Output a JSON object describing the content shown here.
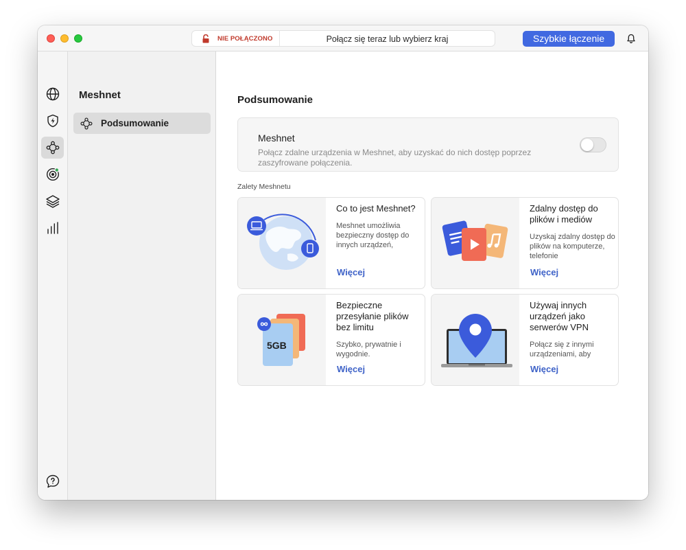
{
  "titlebar": {
    "status": "NIE POŁĄCZONO",
    "prompt": "Połącz się teraz lub wybierz kraj",
    "quick_connect_label": "Szybkie łączenie"
  },
  "rail": {
    "items": [
      {
        "icon": "globe-icon",
        "active": false
      },
      {
        "icon": "shield-bolt-icon",
        "active": false
      },
      {
        "icon": "meshnet-icon",
        "active": true
      },
      {
        "icon": "target-icon",
        "active": false
      },
      {
        "icon": "layers-icon",
        "active": false
      },
      {
        "icon": "stats-icon",
        "active": false
      }
    ],
    "bottom": [
      {
        "icon": "help-icon"
      },
      {
        "icon": "settings-icon"
      }
    ]
  },
  "sidebar": {
    "title": "Meshnet",
    "items": [
      {
        "label": "Podsumowanie",
        "icon": "meshnet-icon",
        "active": true
      }
    ]
  },
  "main": {
    "title": "Podsumowanie",
    "meshnet_card": {
      "title": "Meshnet",
      "description": "Połącz zdalne urządzenia w Meshnet, aby uzyskać do nich dostęp poprzez zaszyfrowane połączenia.",
      "toggle_on": false
    },
    "section_label": "Zalety Meshnetu",
    "features": [
      {
        "title": "Co to jest Meshnet?",
        "description": "Meshnet umożliwia bezpieczny dostęp do innych urządzeń,",
        "more": "Więcej",
        "image": "globe-devices-illustration"
      },
      {
        "title": "Zdalny dostęp do plików i mediów",
        "description": "Uzyskaj zdalny dostęp do plików na komputerze, telefonie",
        "more": "Więcej",
        "image": "media-files-illustration"
      },
      {
        "title": "Bezpieczne przesyłanie plików bez limitu",
        "description": "Szybko, prywatnie i wygodnie.",
        "more": "Więcej",
        "image": "file-transfer-illustration",
        "image_label": "5GB"
      },
      {
        "title": "Używaj innych urządzeń jako serwerów VPN",
        "description": "Połącz się z innymi urządzeniami, aby",
        "more": "Więcej",
        "image": "laptop-pin-illustration"
      }
    ]
  },
  "colors": {
    "accent": "#4169e1",
    "status_red": "#c0392b",
    "link": "#3f63c8"
  }
}
